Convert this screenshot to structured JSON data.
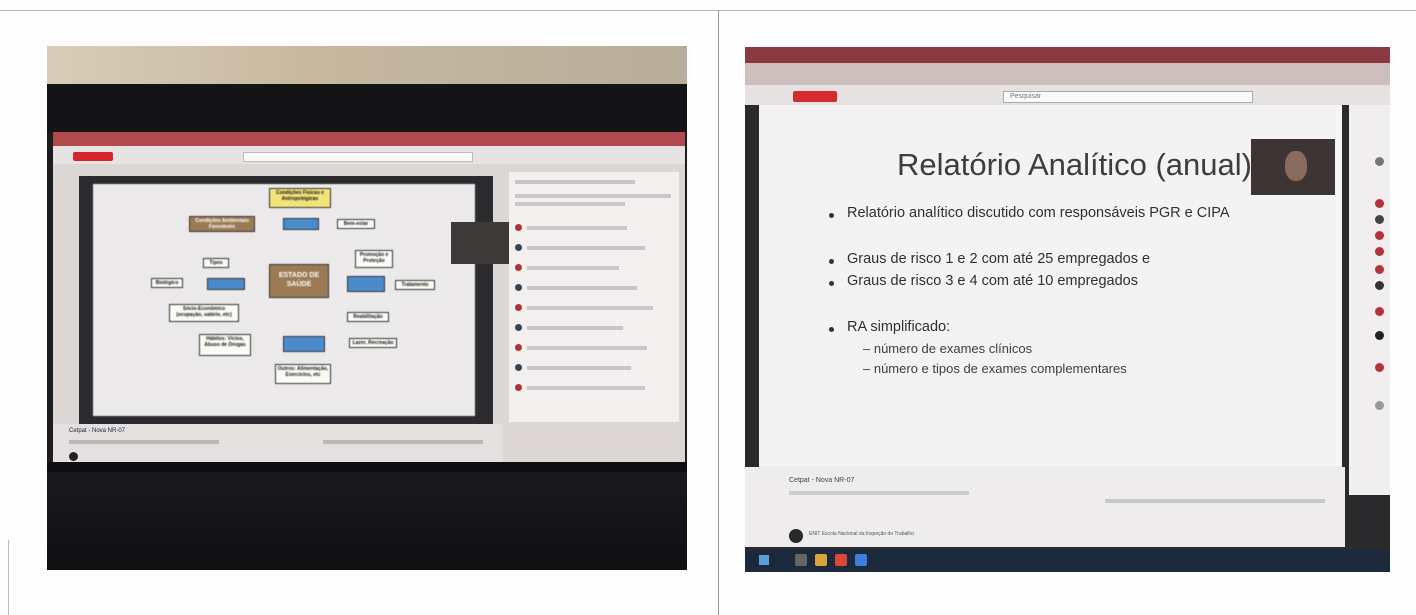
{
  "photo_left": {
    "diagram": {
      "center": "ESTADO DE SAÚDE",
      "nodes": [
        "Condições Físicas e Antropológicas",
        "Condições Ambientais Favoráveis",
        "Bem-estar",
        "Promoção e Proteção",
        "Tipos",
        "Biológico",
        "Tratamento",
        "Sócio-Econômico (ocupação, salário, etc)",
        "Reabilitação",
        "Hábitos: Vícios, Abuso de Drogas",
        "Lazer, Recreação",
        "Outros: Alimentação, Exercícios, etc"
      ]
    },
    "video_title": "Cetpat - Nova NR-07"
  },
  "photo_right": {
    "slide": {
      "title": "Relatório Analítico (anual)",
      "item1": "Relatório analítico discutido com responsáveis PGR e CIPA",
      "item2": "Graus de risco 1 e 2 com até 25 empregados e",
      "item3": "Graus de risco 3 e 4 com até 10 empregados",
      "item4": "RA simplificado:",
      "sub1": "– número de exames clínicos",
      "sub2": "– número e tipos de exames complementares"
    },
    "search_placeholder": "Pesquisar",
    "video_title": "Cetpat - Nova NR-07",
    "channel": "ENIT Escola Nacional da Inspeção do Trabalho"
  },
  "colors": {
    "youtube_red": "#d7262b",
    "slide_bg": "#f4f3f3",
    "diagram_blue": "#4b8bcb",
    "diagram_yellow": "#f1e27a"
  }
}
